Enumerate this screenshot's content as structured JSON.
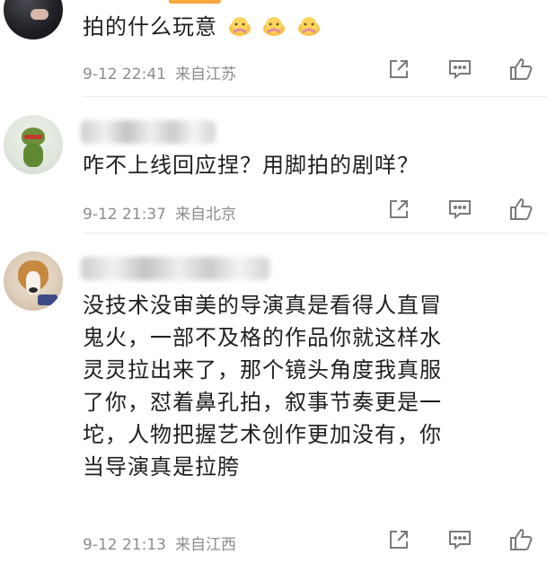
{
  "comments": [
    {
      "text": "拍的什么玩意",
      "emojis": [
        "lotus-emoji",
        "lotus-emoji",
        "lotus-emoji"
      ],
      "time": "9-12 22:41",
      "location": "来自江苏"
    },
    {
      "text": "咋不上线回应捏？用脚拍的剧咩？",
      "time": "9-12 21:37",
      "location": "来自北京"
    },
    {
      "text_lines": [
        "没技术没审美的导演真是看得人直冒",
        "鬼火，一部不及格的作品你就这样水",
        "灵灵拉出来了，那个镜头角度我真服",
        "了你，怼着鼻孔拍，叙事节奏更是一",
        "坨，人物把握艺术创作更加没有，你",
        "当导演真是拉胯"
      ],
      "time": "9-12 21:13",
      "location": "来自江西"
    }
  ],
  "icons": {
    "forward": "share-icon",
    "comment": "comment-icon",
    "like": "like-icon"
  },
  "colors": {
    "accent": "#f7a640",
    "meta": "#8c8c8c"
  }
}
